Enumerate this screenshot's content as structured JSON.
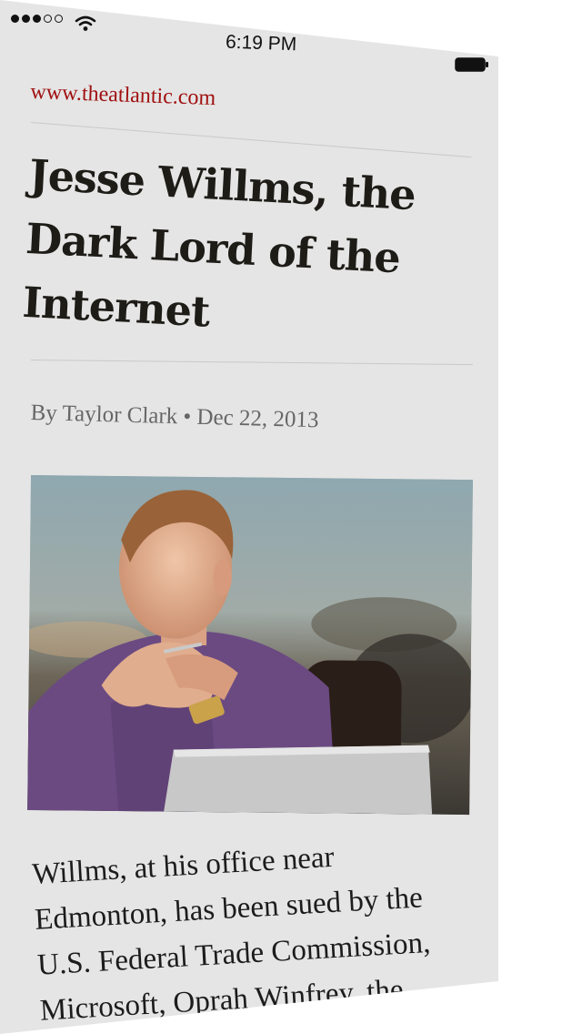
{
  "status_bar": {
    "time": "6:19 PM",
    "signal_bars_filled": 3,
    "signal_bars_total": 5,
    "battery_level": 1.0
  },
  "article": {
    "site_url": "www.theatlantic.com",
    "headline": "Jesse Willms, the Dark Lord of the Internet",
    "byline": "By Taylor Clark • Dec 22, 2013",
    "body_text": "Willms, at his office near Edmonton, has been sued by the U.S. Federal Trade Commission, Microsoft, Oprah Winfrey, the"
  },
  "colors": {
    "accent_link": "#a01010",
    "background": "#e5e5e5",
    "headline_text": "#1e1c17",
    "byline_text": "#666666"
  },
  "icons": {
    "signal": "signal-dots-icon",
    "wifi": "wifi-icon",
    "battery": "battery-icon"
  }
}
